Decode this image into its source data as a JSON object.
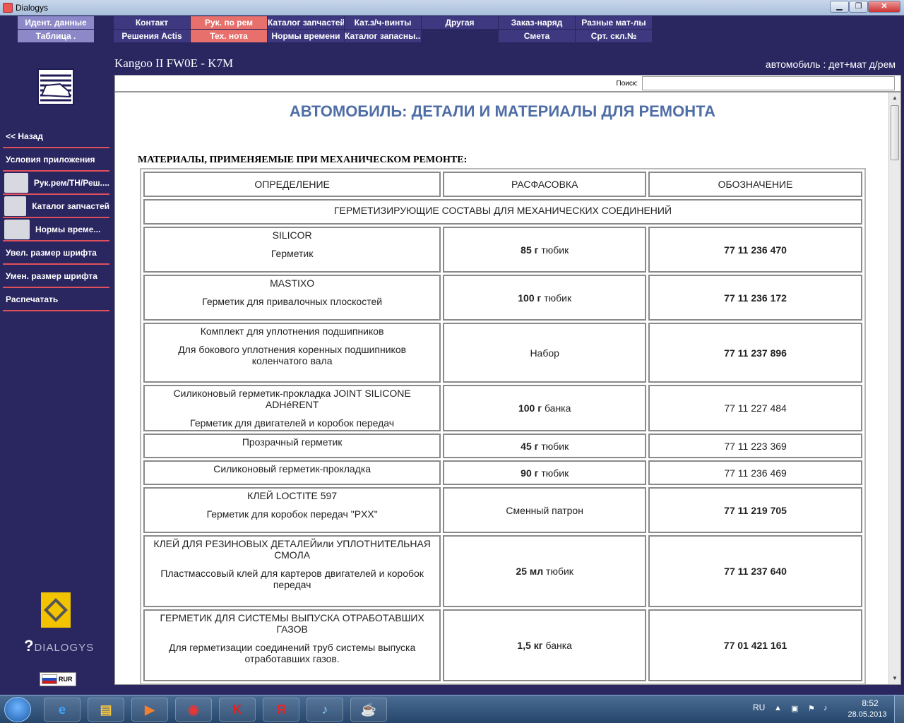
{
  "window": {
    "title": "Dialogys"
  },
  "menu": {
    "row1": [
      {
        "label": "Идент. данные",
        "style": "light"
      },
      {
        "label": "Контакт",
        "style": "dark"
      },
      {
        "label": "Рук. по рем",
        "style": "active"
      },
      {
        "label": "Каталог запчастей",
        "style": "dark"
      },
      {
        "label": "Кат.з/ч-винты",
        "style": "dark"
      },
      {
        "label": "Другая",
        "style": "dark"
      },
      {
        "label": "Заказ-наряд",
        "style": "dark"
      },
      {
        "label": "Разные мат-лы",
        "style": "dark"
      }
    ],
    "row2": [
      {
        "label": "Таблица .",
        "style": "light"
      },
      {
        "label": "Решения Actis",
        "style": "dark"
      },
      {
        "label": "Тех. нота",
        "style": "active"
      },
      {
        "label": "Нормы времени",
        "style": "dark"
      },
      {
        "label": "Каталог запасны...",
        "style": "dark"
      },
      {
        "label": "Смета",
        "style": "dark"
      },
      {
        "label": "Срт. скл.№",
        "style": "dark"
      }
    ]
  },
  "header": {
    "model": "Kangoo II FW0E - K7M",
    "section": "автомобиль : дет+мат д/рем"
  },
  "sidebar": {
    "items": [
      {
        "label": "<< Назад"
      },
      {
        "label": "Условия приложения"
      },
      {
        "label": "Рук.рем/ТН/Реш...."
      },
      {
        "label": "Каталог запчастей"
      },
      {
        "label": "Нормы време..."
      },
      {
        "label": "Увел. размер шрифта"
      },
      {
        "label": "Умен. размер шрифта"
      },
      {
        "label": "Распечатать"
      }
    ],
    "brand": "DIALOGYS",
    "lang_code": "RUR"
  },
  "search": {
    "label": "Поиск:",
    "value": ""
  },
  "document": {
    "heading": "АВТОМОБИЛЬ: ДЕТАЛИ И МАТЕРИАЛЫ ДЛЯ РЕМОНТА",
    "subheading": "МАТЕРИАЛЫ, ПРИМЕНЯЕМЫЕ ПРИ МЕХАНИЧЕСКОМ РЕМОНТЕ:",
    "columns": [
      "ОПРЕДЕЛЕНИЕ",
      "РАСФАСОВКА",
      "ОБОЗНАЧЕНИЕ"
    ],
    "group": "ГЕРМЕТИЗИРУЮЩИЕ СОСТАВЫ ДЛЯ МЕХАНИЧЕСКИХ СОЕДИНЕНИЙ",
    "rows": [
      {
        "name": "SILICOR",
        "desc": "Герметик",
        "qty": "85 г",
        "unit": "тюбик",
        "ref": "77 11 236 470",
        "ref_bold": true
      },
      {
        "name": "MASTIXO",
        "desc": "Герметик для привалочных плоскостей",
        "qty": "100 г",
        "unit": "тюбик",
        "ref": "77 11 236 172",
        "ref_bold": true
      },
      {
        "name": "Комплект для уплотнения подшипников",
        "desc": "Для бокового уплотнения коренных подшипников коленчатого вала",
        "qty": "",
        "unit": "Набор",
        "ref": "77 11 237 896",
        "ref_bold": true
      },
      {
        "name": "Силиконовый герметик-прокладка JOINT SILICONE ADHéRENT",
        "desc": "Герметик для двигателей и коробок передач",
        "qty": "100 г",
        "unit": "банка",
        "ref": "77 11 227 484",
        "ref_bold": false
      },
      {
        "name": "Прозрачный герметик",
        "desc": "",
        "qty": "45 г",
        "unit": "тюбик",
        "ref": "77 11 223 369",
        "ref_bold": false
      },
      {
        "name": "Силиконовый герметик-прокладка",
        "desc": "",
        "qty": "90 г",
        "unit": "тюбик",
        "ref": "77 11 236 469",
        "ref_bold": false
      },
      {
        "name": "КЛЕЙ LOCTITE 597",
        "desc": "Герметик для коробок передач \"PXX\"",
        "qty": "",
        "unit": "Сменный патрон",
        "ref": "77 11 219 705",
        "ref_bold": true
      },
      {
        "name": "КЛЕЙ ДЛЯ РЕЗИНОВЫХ ДЕТАЛЕЙили УПЛОТНИТЕЛЬНАЯ СМОЛА",
        "desc": "Пластмассовый клей для картеров двигателей и коробок передач",
        "qty": "25 мл",
        "unit": "тюбик",
        "ref": "77 11 237 640",
        "ref_bold": true
      },
      {
        "name": "ГЕРМЕТИК ДЛЯ СИСТЕМЫ ВЫПУСКА ОТРАБОТАВШИХ ГАЗОВ",
        "desc": "Для герметизации соединений труб системы выпуска отработавших газов.",
        "qty": "1,5 кг",
        "unit": "банка",
        "ref": "77 01 421 161",
        "ref_bold": true
      }
    ]
  },
  "taskbar": {
    "apps": [
      "e",
      "▤",
      "▶",
      "◉",
      "K",
      "Я",
      "♪",
      "☕"
    ],
    "lang": "RU",
    "time": "8:52",
    "date": "28.05.2013"
  }
}
